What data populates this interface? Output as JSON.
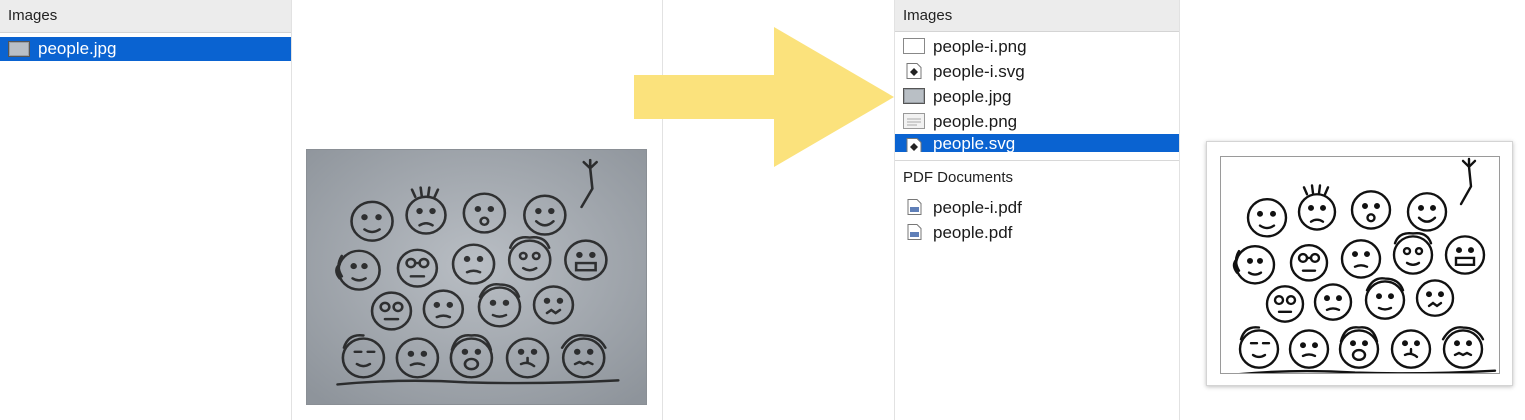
{
  "left": {
    "section_title": "Images",
    "files": [
      {
        "name": "people.jpg",
        "icon": "jpg-thumbnail-icon",
        "selected": true
      }
    ]
  },
  "right": {
    "images_title": "Images",
    "images": [
      {
        "name": "people-i.png",
        "icon": "blank-png-icon"
      },
      {
        "name": "people-i.svg",
        "icon": "svg-document-icon"
      },
      {
        "name": "people.jpg",
        "icon": "jpg-thumbnail-icon"
      },
      {
        "name": "people.png",
        "icon": "png-thumbnail-icon"
      },
      {
        "name": "people.svg",
        "icon": "svg-document-icon",
        "selected": true
      }
    ],
    "pdf_title": "PDF Documents",
    "pdfs": [
      {
        "name": "people-i.pdf",
        "icon": "pdf-document-icon"
      },
      {
        "name": "people.pdf",
        "icon": "pdf-document-icon"
      }
    ]
  },
  "colors": {
    "selection": "#0a63d1",
    "arrow": "#fbe27c",
    "header_bg": "#ececec"
  }
}
